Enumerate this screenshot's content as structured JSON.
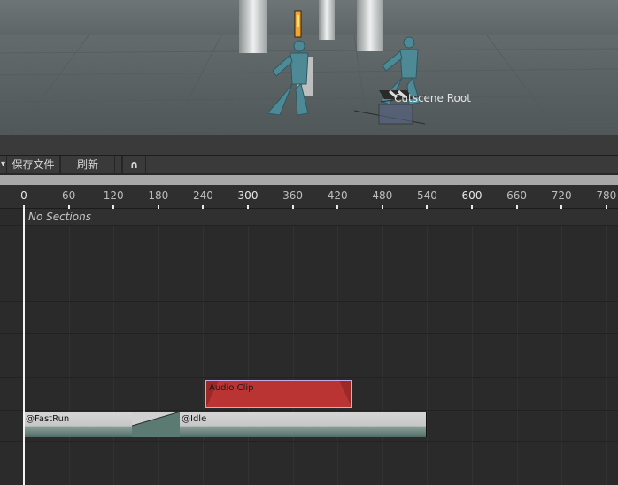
{
  "scene": {
    "cutscene_root_label": "Cutscene Root"
  },
  "toolbar": {
    "dropdown_arrow": "▾",
    "save_label": "保存文件",
    "refresh_label": "刷新",
    "magnet_icon": "∩"
  },
  "ruler": {
    "ticks": [
      "0",
      "60",
      "120",
      "180",
      "240",
      "300",
      "360",
      "420",
      "480",
      "540",
      "600",
      "660",
      "720",
      "780"
    ],
    "major_ticks": [
      "0",
      "300",
      "600"
    ]
  },
  "timeline": {
    "sections_text": "No Sections",
    "audio_clip_label": "Audio Clip",
    "anim_clip_1_label": "@FastRun",
    "anim_clip_2_label": "@Idle"
  },
  "colors": {
    "audio_clip": "#bb3434",
    "audio_clip_border": "#c9a8e8",
    "playhead": "#f2f2f2"
  }
}
